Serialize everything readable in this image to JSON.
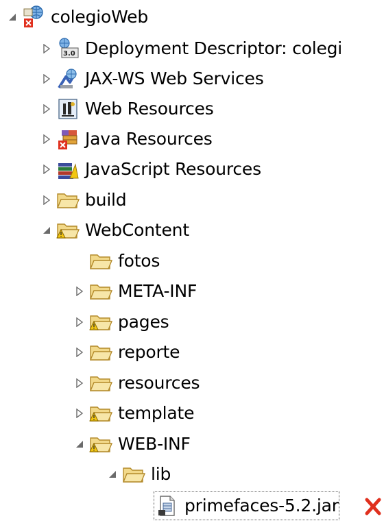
{
  "colors": {
    "folder_fill": "#f2d98a",
    "folder_stroke": "#b38a2a",
    "error_red": "#e0301e",
    "warning_yellow": "#f3c611",
    "twisty": "#6b6b6b"
  },
  "tree": [
    {
      "label": "colegioWeb",
      "icon": "web-project-error-icon",
      "expanded": true
    },
    {
      "label": "Deployment Descriptor: colegi",
      "icon": "deployment-descriptor-icon",
      "expanded": false
    },
    {
      "label": "JAX-WS Web Services",
      "icon": "jaxws-webservices-icon",
      "expanded": false
    },
    {
      "label": "Web Resources",
      "icon": "web-resources-icon",
      "expanded": false
    },
    {
      "label": "Java Resources",
      "icon": "java-resources-error-icon",
      "expanded": false
    },
    {
      "label": "JavaScript Resources",
      "icon": "javascript-resources-icon",
      "expanded": false
    },
    {
      "label": "build",
      "icon": "folder-icon",
      "expanded": false
    },
    {
      "label": "WebContent",
      "icon": "folder-warning-icon",
      "expanded": true
    },
    {
      "label": "fotos",
      "icon": "folder-icon",
      "expanded": null
    },
    {
      "label": "META-INF",
      "icon": "folder-icon",
      "expanded": false
    },
    {
      "label": "pages",
      "icon": "folder-warning-icon",
      "expanded": false
    },
    {
      "label": "reporte",
      "icon": "folder-icon",
      "expanded": false
    },
    {
      "label": "resources",
      "icon": "folder-icon",
      "expanded": false
    },
    {
      "label": "template",
      "icon": "folder-warning-icon",
      "expanded": false
    },
    {
      "label": "WEB-INF",
      "icon": "folder-warning-icon",
      "expanded": true
    },
    {
      "label": "lib",
      "icon": "folder-open-icon",
      "expanded": true
    },
    {
      "label": "primefaces-5.2.jar",
      "icon": "jar-file-icon",
      "expanded": null,
      "selected": true
    }
  ],
  "error_marker_icon": "red-x-error-icon"
}
